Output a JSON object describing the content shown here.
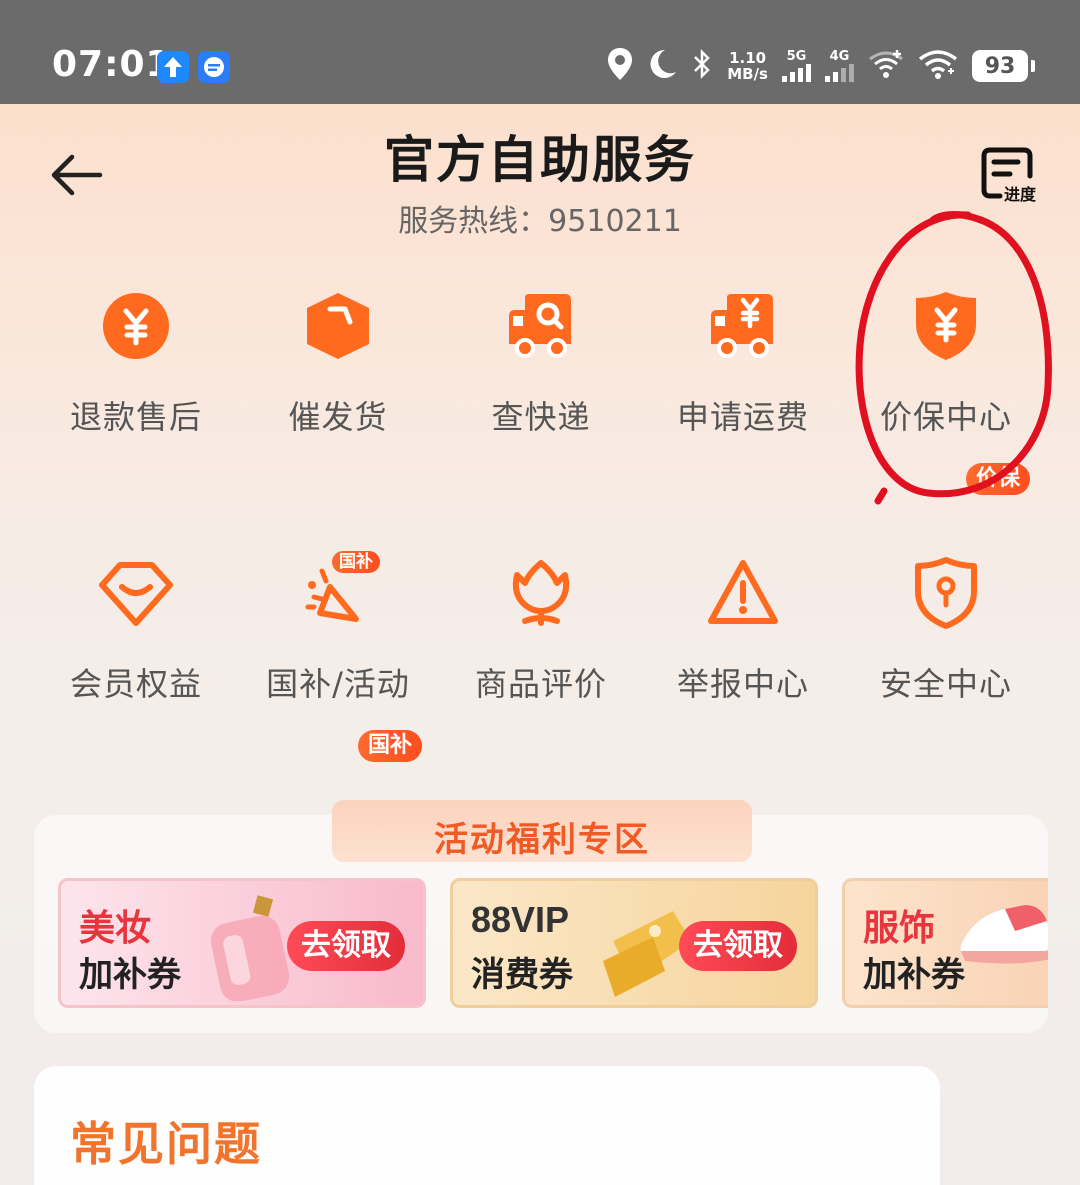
{
  "status_bar": {
    "time": "07:01",
    "net_speed_value": "1.10",
    "net_speed_unit": "MB/s",
    "sim1": "5G",
    "sim2": "4G",
    "battery": "93"
  },
  "header": {
    "title": "官方自助服务",
    "hotline": "服务热线：9510211",
    "progress_label": "进度"
  },
  "services_row1": [
    {
      "label": "退款售后",
      "icon": "yuan-coin-icon"
    },
    {
      "label": "催发货",
      "icon": "package-box-icon"
    },
    {
      "label": "查快递",
      "icon": "truck-search-icon"
    },
    {
      "label": "申请运费",
      "icon": "truck-yuan-icon"
    },
    {
      "label": "价保中心",
      "icon": "shield-yuan-icon",
      "tag": "价保"
    }
  ],
  "services_row2": [
    {
      "label": "会员权益",
      "icon": "diamond-smile-icon"
    },
    {
      "label": "国补/活动",
      "icon": "party-popper-icon",
      "icon_badge": "国补",
      "tag": "国补"
    },
    {
      "label": "商品评价",
      "icon": "flower-icon"
    },
    {
      "label": "举报中心",
      "icon": "warning-triangle-icon"
    },
    {
      "label": "安全中心",
      "icon": "shield-keyhole-icon"
    }
  ],
  "activity": {
    "title": "活动福利专区",
    "coupons": [
      {
        "line1": "美妆",
        "line2": "加补券",
        "button": "去领取",
        "accent": "#e8343c"
      },
      {
        "line1": "88VIP",
        "line2": "消费券",
        "button": "去领取",
        "accent": "#333333"
      },
      {
        "line1": "服饰",
        "line2": "加补券",
        "accent": "#e8343c"
      }
    ]
  },
  "faq": {
    "title": "常见问题"
  },
  "colors": {
    "brand_orange": "#ff6a1f",
    "annotation_red": "#e01020"
  }
}
